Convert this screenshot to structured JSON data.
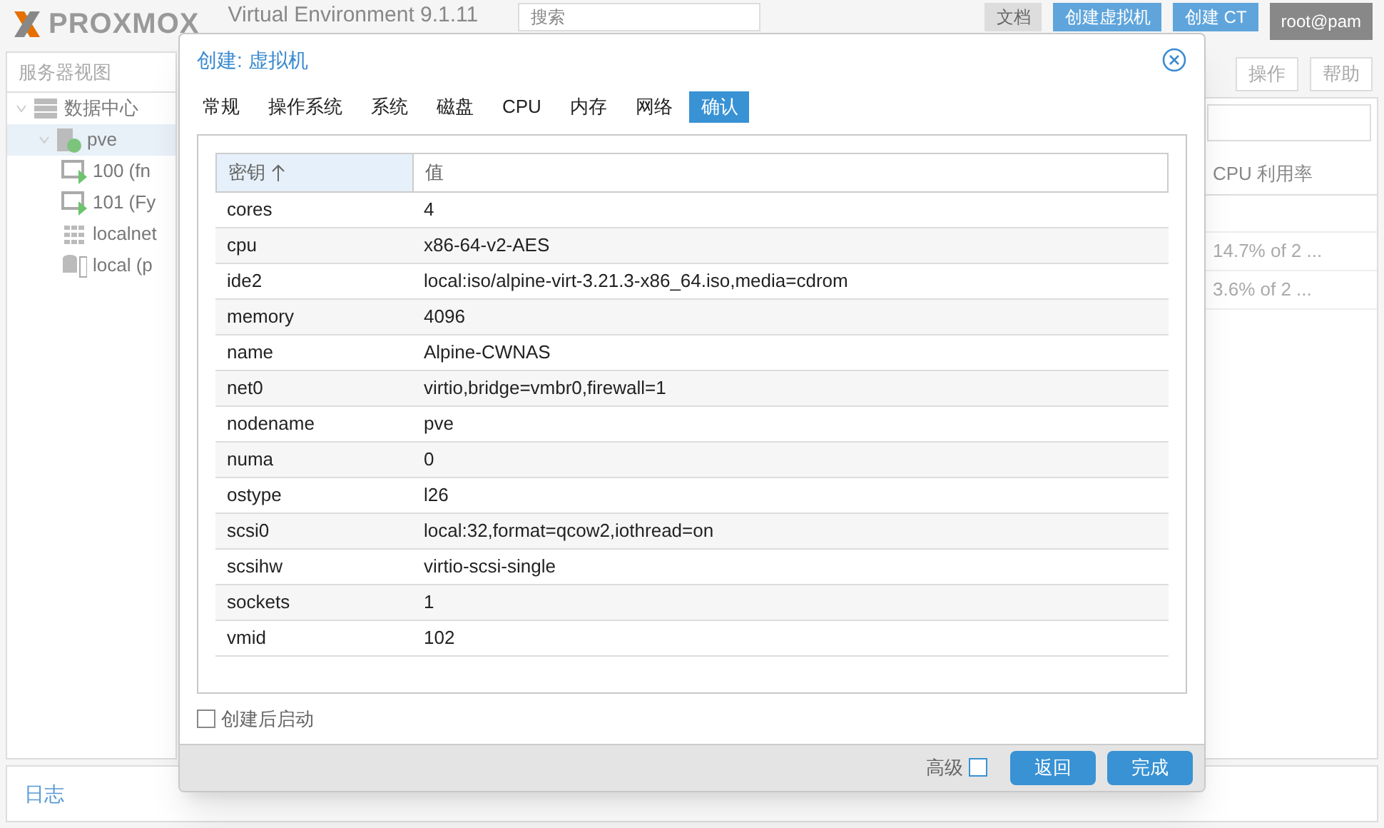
{
  "header": {
    "logo": "PROXMOX",
    "version": "Virtual Environment 9.1.11",
    "search": {
      "placeholder": "搜索"
    },
    "buttons": [
      "文档",
      "创建虚拟机",
      "创建 CT"
    ],
    "user": "root@pam"
  },
  "sidebar": {
    "view": "服务器视图",
    "tree": [
      {
        "label": "数据中心",
        "kind": "datacenter",
        "expanded": true,
        "children": [
          {
            "label": "pve",
            "kind": "node",
            "selected": true,
            "expanded": true,
            "children": [
              {
                "label": "100 (fn",
                "kind": "vm",
                "selected": false
              },
              {
                "label": "101 (Fy",
                "kind": "vm",
                "selected": false
              },
              {
                "label": "localnet",
                "kind": "network",
                "selected": false
              },
              {
                "label": "local (p",
                "kind": "storage",
                "selected": false
              }
            ]
          }
        ]
      }
    ]
  },
  "content": {
    "toolbar": [
      "操作",
      "帮助"
    ],
    "column": "CPU 利用率",
    "rows": [
      "14.7% of 2 ...",
      "3.6% of 2 ..."
    ]
  },
  "log_panel": {
    "title": "日志"
  },
  "dialog": {
    "title": "创建: 虚拟机",
    "tabs": [
      {
        "label": "常规",
        "selected": false
      },
      {
        "label": "操作系统",
        "selected": false
      },
      {
        "label": "系统",
        "selected": false
      },
      {
        "label": "磁盘",
        "selected": false
      },
      {
        "label": "CPU",
        "selected": false
      },
      {
        "label": "内存",
        "selected": false
      },
      {
        "label": "网络",
        "selected": false
      },
      {
        "label": "确认",
        "selected": true
      }
    ],
    "columns": [
      "密钥",
      "值"
    ],
    "rows": [
      [
        "cores",
        "4"
      ],
      [
        "cpu",
        "x86-64-v2-AES"
      ],
      [
        "ide2",
        "local:iso/alpine-virt-3.21.3-x86_64.iso,media=cdrom"
      ],
      [
        "memory",
        "4096"
      ],
      [
        "name",
        "Alpine-CWNAS"
      ],
      [
        "net0",
        "virtio,bridge=vmbr0,firewall=1"
      ],
      [
        "nodename",
        "pve"
      ],
      [
        "numa",
        "0"
      ],
      [
        "ostype",
        "l26"
      ],
      [
        "scsi0",
        "local:32,format=qcow2,iothread=on"
      ],
      [
        "scsihw",
        "virtio-scsi-single"
      ],
      [
        "sockets",
        "1"
      ],
      [
        "vmid",
        "102"
      ]
    ],
    "start_after": {
      "label": "创建后启动",
      "checked": false
    },
    "advanced": {
      "label": "高级",
      "checked": false
    },
    "buttons": [
      "返回",
      "完成"
    ]
  }
}
